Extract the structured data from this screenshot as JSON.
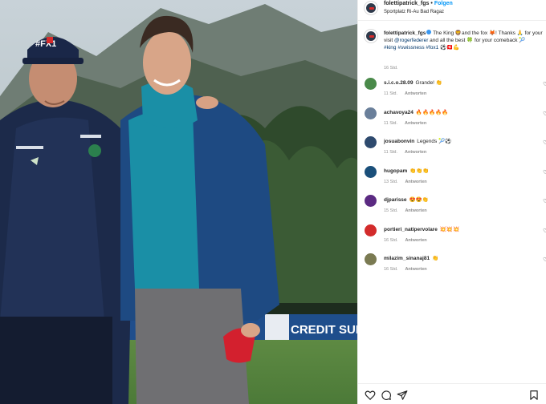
{
  "post": {
    "username": "folettipatrick_fgs",
    "separator": "•",
    "follow_label": "Folgen",
    "location": "Sportplatz Ri-Au Bad Ragaz",
    "caption": {
      "username": "folettipatrick_fgs",
      "text_part1": "The King 🦁and the fox 🦊! Thanks 🙏 for your visit ",
      "mention": "@rogerfederer",
      "text_part2": " and all the best 🍀 for your comeback 🎾",
      "hashtags": "#king #swissness #fox1",
      "emojis_end": "⚽🇨🇭💪",
      "time": "16 Std."
    },
    "reply_label": "Antworten",
    "comments": [
      {
        "user": "s.i.c.o.28.09",
        "text": "Grande! 👏",
        "time": "11 Std.",
        "avatar_color": "#4a8a4a"
      },
      {
        "user": "achavoya24",
        "text": "🔥🔥🔥🔥🔥",
        "time": "11 Std.",
        "avatar_color": "#6a7f9a"
      },
      {
        "user": "josuabonvin",
        "text": "Legends 🎾⚽",
        "time": "11 Std.",
        "avatar_color": "#2e4a6e"
      },
      {
        "user": "hugopam",
        "text": "👏👏👏",
        "time": "13 Std.",
        "avatar_color": "#1a4f7a"
      },
      {
        "user": "djparisse",
        "text": "😍😍👏",
        "time": "15 Std.",
        "avatar_color": "#5b2a82"
      },
      {
        "user": "portieri_natipervolare",
        "text": "💥💥💥",
        "time": "16 Std.",
        "avatar_color": "#d32b2b"
      },
      {
        "user": "milazim_sinanaj81",
        "text": "👏",
        "time": "16 Std.",
        "avatar_color": "#7a7a52"
      }
    ],
    "photo_banner": "CREDIT SUISSE",
    "cap_text": "#FX1"
  }
}
